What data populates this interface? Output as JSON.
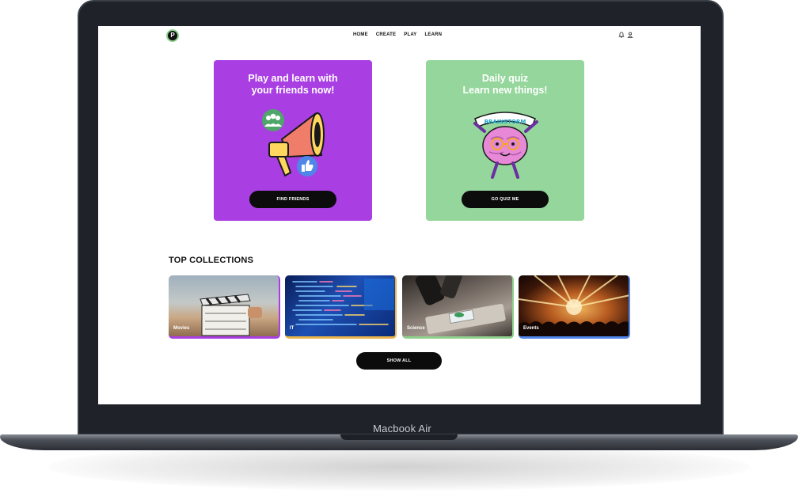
{
  "device": {
    "label": "Macbook Air"
  },
  "nav": {
    "logo_glyph": "P",
    "items": [
      "HOME",
      "CREATE",
      "PLAY",
      "LEARN"
    ],
    "icons": [
      "bell-icon",
      "user-icon"
    ]
  },
  "promo_cards": [
    {
      "title": "Play and learn with\nyour friends now!",
      "button": "FIND FRIENDS",
      "color": "#a93fe3",
      "illustration": "megaphone-icon"
    },
    {
      "title": "Daily quiz\nLearn new things!",
      "button": "GO QUIZ ME",
      "color": "#94d69b",
      "illustration": "brain-icon",
      "sticker_text": "BRAINSTORM"
    }
  ],
  "collections": {
    "title": "TOP COLLECTIONS",
    "items": [
      {
        "label": "Movies",
        "accent": "#a93fe3"
      },
      {
        "label": "IT",
        "accent": "#e9b34b"
      },
      {
        "label": "Science",
        "accent": "#8fd18c"
      },
      {
        "label": "Events",
        "accent": "#4f86e8"
      }
    ],
    "show_all": "SHOW ALL"
  }
}
